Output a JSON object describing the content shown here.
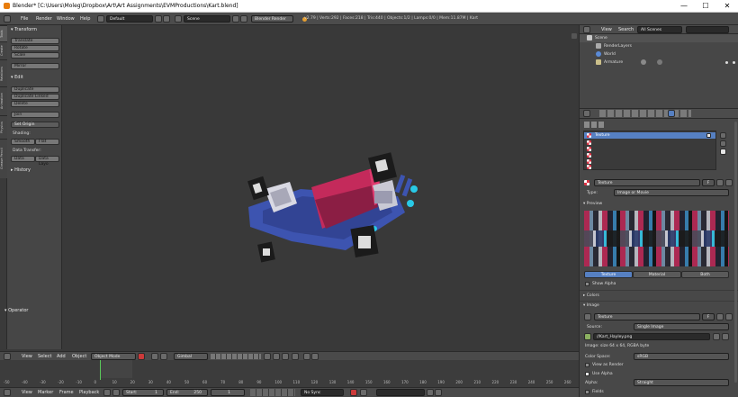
{
  "window": {
    "title": "Blender* [C:\\Users\\Moleg\\Dropbox\\Art\\Art Assignments\\EVMProductions\\Kart.blend]",
    "min": "—",
    "max": "☐",
    "close": "✕"
  },
  "menubar": {
    "items": [
      "File",
      "Render",
      "Window",
      "Help"
    ],
    "layout": "Default",
    "scene": "Scene",
    "engine": "Blender Render",
    "stats": "v2.79 | Verts:292 | Faces:218 | Tris:440 | Objects:1/2 | Lamps:0/0 | Mem:11.87M | Kart"
  },
  "tool_tabs": [
    "Tools",
    "Create",
    "Relations",
    "Animation",
    "Physics",
    "Grease Pencil"
  ],
  "toolshelf": {
    "transform_header": "Transform",
    "translate": "Translate",
    "rotate": "Rotate",
    "scale": "Scale",
    "mirror": "Mirror",
    "edit_header": "Edit",
    "duplicate": "Duplicate",
    "duplicate_linked": "Duplicate Linked",
    "delete": "Delete",
    "join": "Join",
    "set_origin": "Set Origin",
    "shading_label": "Shading:",
    "smooth": "Smooth",
    "flat": "Flat",
    "data_transfer_label": "Data Transfer:",
    "data": "Data",
    "data_layo": "Data Layo",
    "history_header": "History",
    "operator_header": "Operator"
  },
  "viewport_header": {
    "items": [
      "View",
      "Select",
      "Add",
      "Object"
    ],
    "mode": "Object Mode",
    "orientation": "Gimbal"
  },
  "timeline": {
    "ticks": [
      "-50",
      "-40",
      "-30",
      "-20",
      "-10",
      "0",
      "10",
      "20",
      "30",
      "40",
      "50",
      "60",
      "70",
      "80",
      "90",
      "100",
      "110",
      "120",
      "130",
      "140",
      "150",
      "160",
      "170",
      "180",
      "190",
      "200",
      "210",
      "220",
      "230",
      "240",
      "250",
      "260"
    ],
    "menu": [
      "View",
      "Marker",
      "Frame",
      "Playback"
    ],
    "start": "Start:",
    "start_val": "1",
    "end": "End:",
    "end_val": "250",
    "current": "1",
    "sync": "No Sync"
  },
  "outliner": {
    "view": "View",
    "search": "Search",
    "filter": "All Scenes",
    "rows": [
      "Scene",
      "RenderLayers",
      "World",
      "Armature"
    ]
  },
  "texture_panel": {
    "slot_selected": "Texture",
    "texture_name": "Texture",
    "f_label": "F",
    "type_label": "Type:",
    "type_value": "Image or Movie",
    "preview_header": "Preview",
    "tabs": [
      "Texture",
      "Material",
      "Both"
    ],
    "show_alpha": "Show Alpha",
    "colors_header": "Colors",
    "image_header": "Image",
    "image_field": "Texture",
    "source_label": "Source:",
    "source_value": "Single Image",
    "filename": "//Kart_Hayley.png",
    "image_info": "Image: size 64 x 64, RGBA byte",
    "color_space_label": "Color Space:",
    "color_space_value": "sRGB",
    "view_as_render": "View as Render",
    "use_alpha": "Use Alpha",
    "alpha_label": "Alpha:",
    "alpha_value": "Straight",
    "fields": "Fields"
  },
  "colors": {
    "accent": "#5680c2",
    "panel": "#484848",
    "viewport": "#393939",
    "kart_blue": "#3d54b0",
    "kart_pink": "#c42a5b",
    "kart_cyan": "#29c9e6",
    "frame_green": "#5ac85a"
  }
}
